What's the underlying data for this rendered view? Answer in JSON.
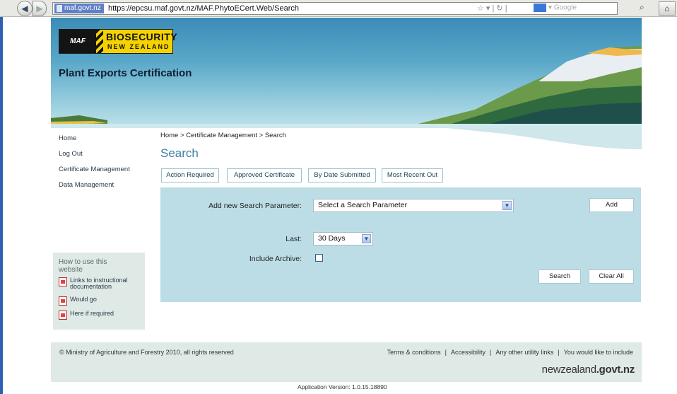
{
  "browser": {
    "site_badge": "maf.govt.nz",
    "url": "https://epcsu.maf.govt.nz/MAF.PhytoECert.Web/Search",
    "search_placeholder": "Google",
    "back_glyph": "◀",
    "forward_glyph": "▶",
    "home_glyph": "⌂",
    "icons": [
      "back-icon",
      "forward-icon",
      "star-icon",
      "refresh-icon",
      "google-icon",
      "search-icon",
      "home-icon"
    ]
  },
  "header": {
    "logo_maf": "MAF",
    "logo_biosecurity": "BIOSECURITY",
    "logo_nz": "NEW ZEALAND",
    "site_title": "Plant Exports Certification"
  },
  "left_nav": {
    "items": [
      "Home",
      "Log Out",
      "Certificate Management",
      "Data Management"
    ]
  },
  "help": {
    "title_line1": "How to use this",
    "title_line2": "website",
    "links": [
      {
        "line1": "Links to instructional",
        "line2": "documentation"
      },
      {
        "line1": "Would go",
        "line2": ""
      },
      {
        "line1": "Here if required",
        "line2": ""
      }
    ]
  },
  "breadcrumb": "Home > Certificate Management > Search",
  "page_heading": "Search",
  "tabs": [
    "Action Required",
    "Approved Certificate",
    "By Date Submitted",
    "Most Recent Out"
  ],
  "search_form": {
    "param_label": "Add new Search Parameter:",
    "param_value": "Select a Search Parameter",
    "add_label": "Add",
    "last_label": "Last:",
    "last_value": "30 Days",
    "archive_label": "Include Archive:",
    "archive_checked": false,
    "search_label": "Search",
    "clear_label": "Clear All"
  },
  "footer": {
    "copyright": "© Ministry of Agriculture and Forestry 2010, all rights reserved",
    "links": [
      "Terms & conditions",
      "Accessibility",
      "Any other utility links",
      "You would like to include"
    ],
    "nzgovt_prefix": "newzealand",
    "nzgovt_suffix": ".govt.nz",
    "version": "Application Version: 1.0.15.18890"
  },
  "colors": {
    "heading": "#3e7fa6",
    "panel": "#bcdde6",
    "footer_bg": "#dfe9e5",
    "logo_yellow": "#f5d300"
  }
}
